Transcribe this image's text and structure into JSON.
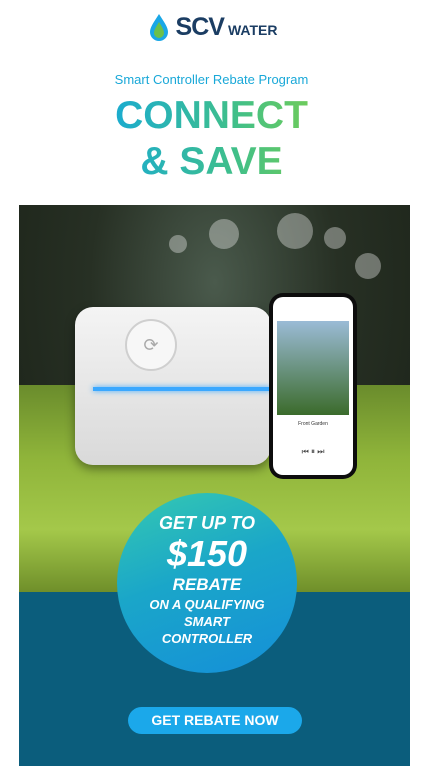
{
  "logo": {
    "icon": "water-drop-icon",
    "text_scv": "SCV",
    "text_water": "WATER"
  },
  "program_title": "Smart Controller Rebate Program",
  "headline": {
    "line1": "CONNECT",
    "line2": "& SAVE"
  },
  "hero": {
    "phone_screen": {
      "title": "Front Garden",
      "controls": "⏮  ⏸  ⏭"
    }
  },
  "badge": {
    "line1": "GET UP TO",
    "amount": "$150",
    "line3": "REBATE",
    "line4": "ON A QUALIFYING",
    "line5": "SMART",
    "line6": "CONTROLLER"
  },
  "cta": {
    "label": "GET REBATE NOW"
  },
  "colors": {
    "navy": "#1b3d63",
    "teal_band": "#0b5d7c",
    "cta": "#1ba8ea",
    "accent_green": "#8bd33c"
  }
}
